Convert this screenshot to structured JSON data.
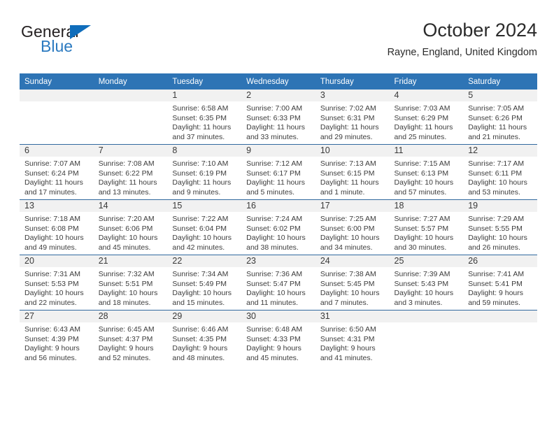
{
  "brand": {
    "name_top": "General",
    "name_bottom": "Blue",
    "triangle_icon": "triangle-icon",
    "color_dark": "#231f20",
    "color_blue": "#2b7ac0"
  },
  "header": {
    "title": "October 2024",
    "subtitle": "Rayne, England, United Kingdom",
    "accent_color": "#2e74b5",
    "daynum_band_color": "#f1f1f1",
    "week_divider_color": "#31699f"
  },
  "weekday_headers": [
    "Sunday",
    "Monday",
    "Tuesday",
    "Wednesday",
    "Thursday",
    "Friday",
    "Saturday"
  ],
  "labels": {
    "sunrise_prefix": "Sunrise:",
    "sunset_prefix": "Sunset:",
    "daylight_prefix": "Daylight:"
  },
  "weeks": [
    [
      {
        "day": "",
        "empty": true,
        "sunrise": "",
        "sunset": "",
        "daylight": ""
      },
      {
        "day": "",
        "empty": true,
        "sunrise": "",
        "sunset": "",
        "daylight": ""
      },
      {
        "day": "1",
        "sunrise": "Sunrise: 6:58 AM",
        "sunset": "Sunset: 6:35 PM",
        "daylight": "Daylight: 11 hours and 37 minutes."
      },
      {
        "day": "2",
        "sunrise": "Sunrise: 7:00 AM",
        "sunset": "Sunset: 6:33 PM",
        "daylight": "Daylight: 11 hours and 33 minutes."
      },
      {
        "day": "3",
        "sunrise": "Sunrise: 7:02 AM",
        "sunset": "Sunset: 6:31 PM",
        "daylight": "Daylight: 11 hours and 29 minutes."
      },
      {
        "day": "4",
        "sunrise": "Sunrise: 7:03 AM",
        "sunset": "Sunset: 6:29 PM",
        "daylight": "Daylight: 11 hours and 25 minutes."
      },
      {
        "day": "5",
        "sunrise": "Sunrise: 7:05 AM",
        "sunset": "Sunset: 6:26 PM",
        "daylight": "Daylight: 11 hours and 21 minutes."
      }
    ],
    [
      {
        "day": "6",
        "sunrise": "Sunrise: 7:07 AM",
        "sunset": "Sunset: 6:24 PM",
        "daylight": "Daylight: 11 hours and 17 minutes."
      },
      {
        "day": "7",
        "sunrise": "Sunrise: 7:08 AM",
        "sunset": "Sunset: 6:22 PM",
        "daylight": "Daylight: 11 hours and 13 minutes."
      },
      {
        "day": "8",
        "sunrise": "Sunrise: 7:10 AM",
        "sunset": "Sunset: 6:19 PM",
        "daylight": "Daylight: 11 hours and 9 minutes."
      },
      {
        "day": "9",
        "sunrise": "Sunrise: 7:12 AM",
        "sunset": "Sunset: 6:17 PM",
        "daylight": "Daylight: 11 hours and 5 minutes."
      },
      {
        "day": "10",
        "sunrise": "Sunrise: 7:13 AM",
        "sunset": "Sunset: 6:15 PM",
        "daylight": "Daylight: 11 hours and 1 minute."
      },
      {
        "day": "11",
        "sunrise": "Sunrise: 7:15 AM",
        "sunset": "Sunset: 6:13 PM",
        "daylight": "Daylight: 10 hours and 57 minutes."
      },
      {
        "day": "12",
        "sunrise": "Sunrise: 7:17 AM",
        "sunset": "Sunset: 6:11 PM",
        "daylight": "Daylight: 10 hours and 53 minutes."
      }
    ],
    [
      {
        "day": "13",
        "sunrise": "Sunrise: 7:18 AM",
        "sunset": "Sunset: 6:08 PM",
        "daylight": "Daylight: 10 hours and 49 minutes."
      },
      {
        "day": "14",
        "sunrise": "Sunrise: 7:20 AM",
        "sunset": "Sunset: 6:06 PM",
        "daylight": "Daylight: 10 hours and 45 minutes."
      },
      {
        "day": "15",
        "sunrise": "Sunrise: 7:22 AM",
        "sunset": "Sunset: 6:04 PM",
        "daylight": "Daylight: 10 hours and 42 minutes."
      },
      {
        "day": "16",
        "sunrise": "Sunrise: 7:24 AM",
        "sunset": "Sunset: 6:02 PM",
        "daylight": "Daylight: 10 hours and 38 minutes."
      },
      {
        "day": "17",
        "sunrise": "Sunrise: 7:25 AM",
        "sunset": "Sunset: 6:00 PM",
        "daylight": "Daylight: 10 hours and 34 minutes."
      },
      {
        "day": "18",
        "sunrise": "Sunrise: 7:27 AM",
        "sunset": "Sunset: 5:57 PM",
        "daylight": "Daylight: 10 hours and 30 minutes."
      },
      {
        "day": "19",
        "sunrise": "Sunrise: 7:29 AM",
        "sunset": "Sunset: 5:55 PM",
        "daylight": "Daylight: 10 hours and 26 minutes."
      }
    ],
    [
      {
        "day": "20",
        "sunrise": "Sunrise: 7:31 AM",
        "sunset": "Sunset: 5:53 PM",
        "daylight": "Daylight: 10 hours and 22 minutes."
      },
      {
        "day": "21",
        "sunrise": "Sunrise: 7:32 AM",
        "sunset": "Sunset: 5:51 PM",
        "daylight": "Daylight: 10 hours and 18 minutes."
      },
      {
        "day": "22",
        "sunrise": "Sunrise: 7:34 AM",
        "sunset": "Sunset: 5:49 PM",
        "daylight": "Daylight: 10 hours and 15 minutes."
      },
      {
        "day": "23",
        "sunrise": "Sunrise: 7:36 AM",
        "sunset": "Sunset: 5:47 PM",
        "daylight": "Daylight: 10 hours and 11 minutes."
      },
      {
        "day": "24",
        "sunrise": "Sunrise: 7:38 AM",
        "sunset": "Sunset: 5:45 PM",
        "daylight": "Daylight: 10 hours and 7 minutes."
      },
      {
        "day": "25",
        "sunrise": "Sunrise: 7:39 AM",
        "sunset": "Sunset: 5:43 PM",
        "daylight": "Daylight: 10 hours and 3 minutes."
      },
      {
        "day": "26",
        "sunrise": "Sunrise: 7:41 AM",
        "sunset": "Sunset: 5:41 PM",
        "daylight": "Daylight: 9 hours and 59 minutes."
      }
    ],
    [
      {
        "day": "27",
        "sunrise": "Sunrise: 6:43 AM",
        "sunset": "Sunset: 4:39 PM",
        "daylight": "Daylight: 9 hours and 56 minutes."
      },
      {
        "day": "28",
        "sunrise": "Sunrise: 6:45 AM",
        "sunset": "Sunset: 4:37 PM",
        "daylight": "Daylight: 9 hours and 52 minutes."
      },
      {
        "day": "29",
        "sunrise": "Sunrise: 6:46 AM",
        "sunset": "Sunset: 4:35 PM",
        "daylight": "Daylight: 9 hours and 48 minutes."
      },
      {
        "day": "30",
        "sunrise": "Sunrise: 6:48 AM",
        "sunset": "Sunset: 4:33 PM",
        "daylight": "Daylight: 9 hours and 45 minutes."
      },
      {
        "day": "31",
        "sunrise": "Sunrise: 6:50 AM",
        "sunset": "Sunset: 4:31 PM",
        "daylight": "Daylight: 9 hours and 41 minutes."
      },
      {
        "day": "",
        "empty": true,
        "sunrise": "",
        "sunset": "",
        "daylight": ""
      },
      {
        "day": "",
        "empty": true,
        "sunrise": "",
        "sunset": "",
        "daylight": ""
      }
    ]
  ]
}
